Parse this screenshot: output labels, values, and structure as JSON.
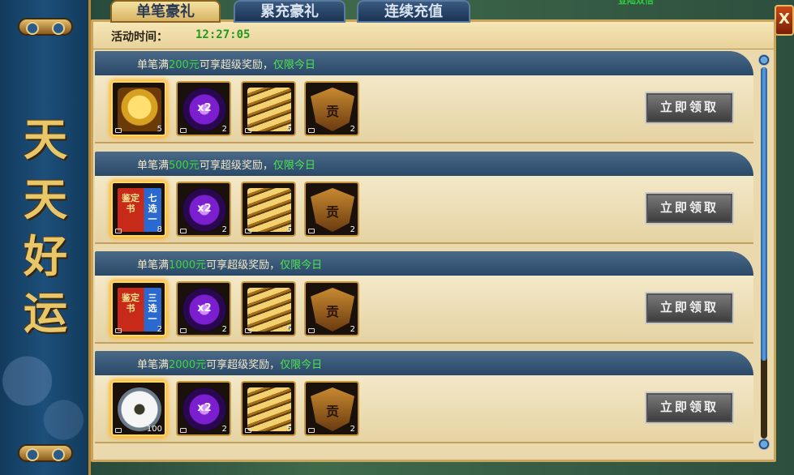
{
  "banner": {
    "chars": [
      "天",
      "天",
      "好",
      "运"
    ]
  },
  "tabs": [
    {
      "label": "单笔豪礼",
      "active": true
    },
    {
      "label": "累充豪礼",
      "active": false
    },
    {
      "label": "连续充值",
      "active": false
    }
  ],
  "top_right_text": "登陆双倍",
  "close_label": "X",
  "activity": {
    "label": "活动时间：",
    "time": "12:27:05"
  },
  "rows": [
    {
      "prefix": "单笔满",
      "amount": "200元",
      "suffix": "可享超级奖励，",
      "limit": "仅限今日",
      "items": [
        {
          "icon": "golden-egg-icon",
          "count": "5"
        },
        {
          "icon": "double-exp-orb-icon",
          "label": "x2",
          "count": "2"
        },
        {
          "icon": "gold-ingot-icon",
          "count": "5"
        },
        {
          "icon": "shield-token-icon",
          "label": "贡",
          "count": "2"
        }
      ],
      "button": "立即领取"
    },
    {
      "prefix": "单笔满",
      "amount": "500元",
      "suffix": "可享超级奖励，",
      "limit": "仅限今日",
      "items": [
        {
          "icon": "appraisal-book-icon",
          "label": "鉴定书",
          "tag": "七选一",
          "count": "8"
        },
        {
          "icon": "double-exp-orb-icon",
          "label": "x2",
          "count": "2"
        },
        {
          "icon": "gold-ingot-icon",
          "count": "5"
        },
        {
          "icon": "shield-token-icon",
          "label": "贡",
          "count": "2"
        }
      ],
      "button": "立即领取"
    },
    {
      "prefix": "单笔满",
      "amount": "1000元",
      "suffix": "可享超级奖励，",
      "limit": "仅限今日",
      "items": [
        {
          "icon": "appraisal-book-icon",
          "label": "鉴定书",
          "tag": "三选一",
          "count": "2"
        },
        {
          "icon": "double-exp-orb-icon",
          "label": "x2",
          "count": "2"
        },
        {
          "icon": "gold-ingot-icon",
          "count": "5"
        },
        {
          "icon": "shield-token-icon",
          "label": "贡",
          "count": "2"
        }
      ],
      "button": "立即领取"
    },
    {
      "prefix": "单笔满",
      "amount": "2000元",
      "suffix": "可享超级奖励，",
      "limit": "仅限今日",
      "items": [
        {
          "icon": "white-flower-icon",
          "count": "100"
        },
        {
          "icon": "double-exp-orb-icon",
          "label": "x2",
          "count": "2"
        },
        {
          "icon": "gold-ingot-icon",
          "count": "5"
        },
        {
          "icon": "shield-token-icon",
          "label": "贡",
          "count": "2"
        }
      ],
      "button": "立即领取"
    }
  ]
}
